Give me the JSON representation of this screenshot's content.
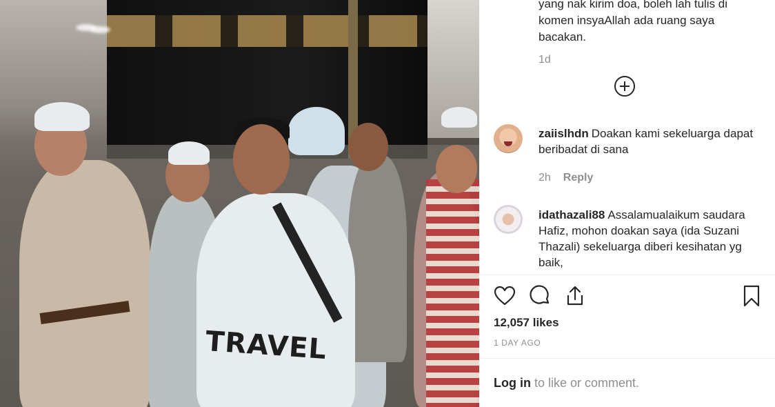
{
  "caption": {
    "text": "yang nak kirim doa, boleh lah tulis di komen insyaAllah ada ruang saya bacakan.",
    "age": "1d"
  },
  "load_more": {
    "icon": "plus-circle-icon"
  },
  "comments": [
    {
      "username": "zaiislhdn",
      "text": "Doakan kami sekeluarga dapat beribadat di sana",
      "age": "2h",
      "reply_label": "Reply"
    },
    {
      "username": "idathazali88",
      "text": "Assalamualaikum saudara Hafiz, mohon doakan saya (ida Suzani Thazali) sekeluarga diberi kesihatan yg baik,"
    }
  ],
  "actions": {
    "like_icon": "heart-icon",
    "comment_icon": "comment-icon",
    "share_icon": "share-icon",
    "save_icon": "bookmark-icon"
  },
  "likes": "12,057 likes",
  "date": "1 DAY AGO",
  "login": {
    "link": "Log in",
    "rest": " to like or comment."
  },
  "photo": {
    "overlay_text": "TRAVEL"
  }
}
